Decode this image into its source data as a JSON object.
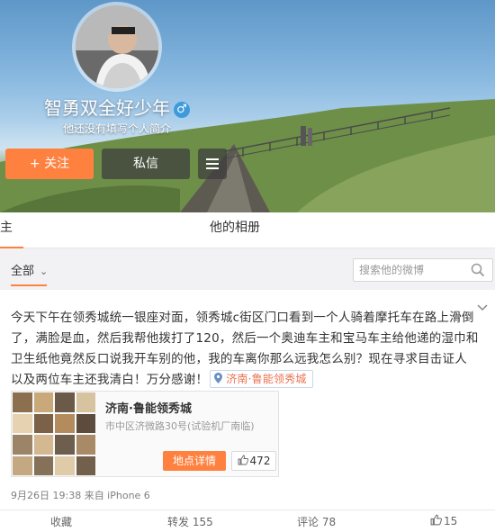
{
  "profile": {
    "name": "智勇双全好少年",
    "gender_symbol": "♂",
    "bio": "他还没有填写个人简介"
  },
  "buttons": {
    "follow": "+ 关注",
    "message": "私信"
  },
  "tabs": [
    {
      "label": "主页"
    },
    {
      "label": "他的相册"
    }
  ],
  "filter": {
    "all_label": "全部",
    "chevron": "⌄",
    "search_placeholder": "搜索他的微博"
  },
  "post": {
    "text": "今天下午在领秀城统一银座对面，领秀城c街区门口看到一个人骑着摩托车在路上滑倒了，满脸是血，然后我帮他拨打了120，然后一个奥迪车主和宝马车主给他递的湿巾和卫生纸他竟然反口说我开车别的他，我的车离你那么远我怎么别？现在寻求目击证人以及两位车主还我清白！万分感谢！",
    "location_tag": "济南·鲁能领秀城",
    "poi": {
      "name": "济南·鲁能领秀城",
      "address": "市中区济微路30号(试验机厂南临)",
      "detail_label": "地点详情",
      "likes": "472"
    },
    "meta": "9月26日 19:38 来自 iPhone 6",
    "actions": {
      "favorite": "收藏",
      "repost": "转发 155",
      "comment": "评论 78",
      "like": "15"
    }
  },
  "colors": {
    "accent": "#ff8140",
    "location_text": "#eb7350",
    "gender_badge": "#3d9bdb"
  }
}
